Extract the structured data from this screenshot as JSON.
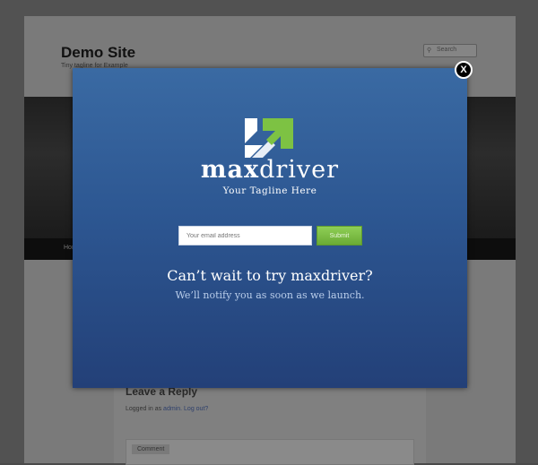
{
  "background_page": {
    "site_title": "Demo Site",
    "site_description": "Tiny tagline for Example",
    "search_placeholder": "Search",
    "nav_home": "Home",
    "reply_title": "Leave a Reply",
    "logged_in_prefix": "Logged in as",
    "logged_in_user": "admin",
    "logout_link": "Log out?",
    "comment_label": "Comment"
  },
  "modal": {
    "close_label": "X",
    "brand_bold": "max",
    "brand_light": "driver",
    "tagline": "Your Tagline Here",
    "email_placeholder": "Your email address",
    "submit_label": "Submit",
    "headline": "Can’t wait to try maxdriver?",
    "subline": "We’ll notify you as soon as we launch."
  },
  "colors": {
    "modal_top": "#3a6aa3",
    "modal_bottom": "#234078",
    "accent_green": "#7dc243",
    "overlay": "#525252"
  },
  "icons": [
    "search-icon",
    "close-icon",
    "maxdriver-logo-icon"
  ]
}
